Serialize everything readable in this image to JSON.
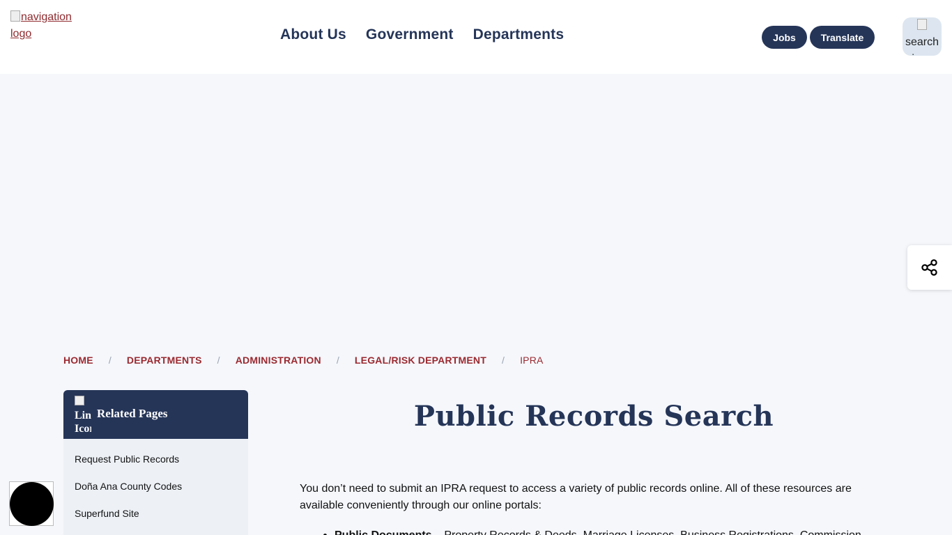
{
  "header": {
    "logo_alt": "navigation logo",
    "nav": [
      "About Us",
      "Government",
      "Departments"
    ],
    "jobs_label": "Jobs",
    "translate_label": "Translate",
    "search_alt": "search icon"
  },
  "breadcrumb": {
    "items": [
      "HOME",
      "DEPARTMENTS",
      "ADMINISTRATION",
      "LEGAL/RISK DEPARTMENT"
    ],
    "current": "IPRA"
  },
  "sidebar": {
    "icon_alt": "Link Icon",
    "title": "Related Pages",
    "items": [
      "Request Public Records",
      "Doña Ana County Codes",
      "Superfund Site"
    ]
  },
  "main": {
    "title": "Public Records Search",
    "intro": "You don’t need to submit an IPRA request to access a variety of public records online. All of these resources are available conveniently through our online portals:",
    "bullet_bold": "Public Documents",
    "bullet_text": " – Property Records & Deeds, Marriage Licenses, Business Registrations, Commission"
  },
  "colors": {
    "navy": "#253558",
    "crimson": "#9a2a30",
    "page_bg": "#f5f7fb"
  }
}
